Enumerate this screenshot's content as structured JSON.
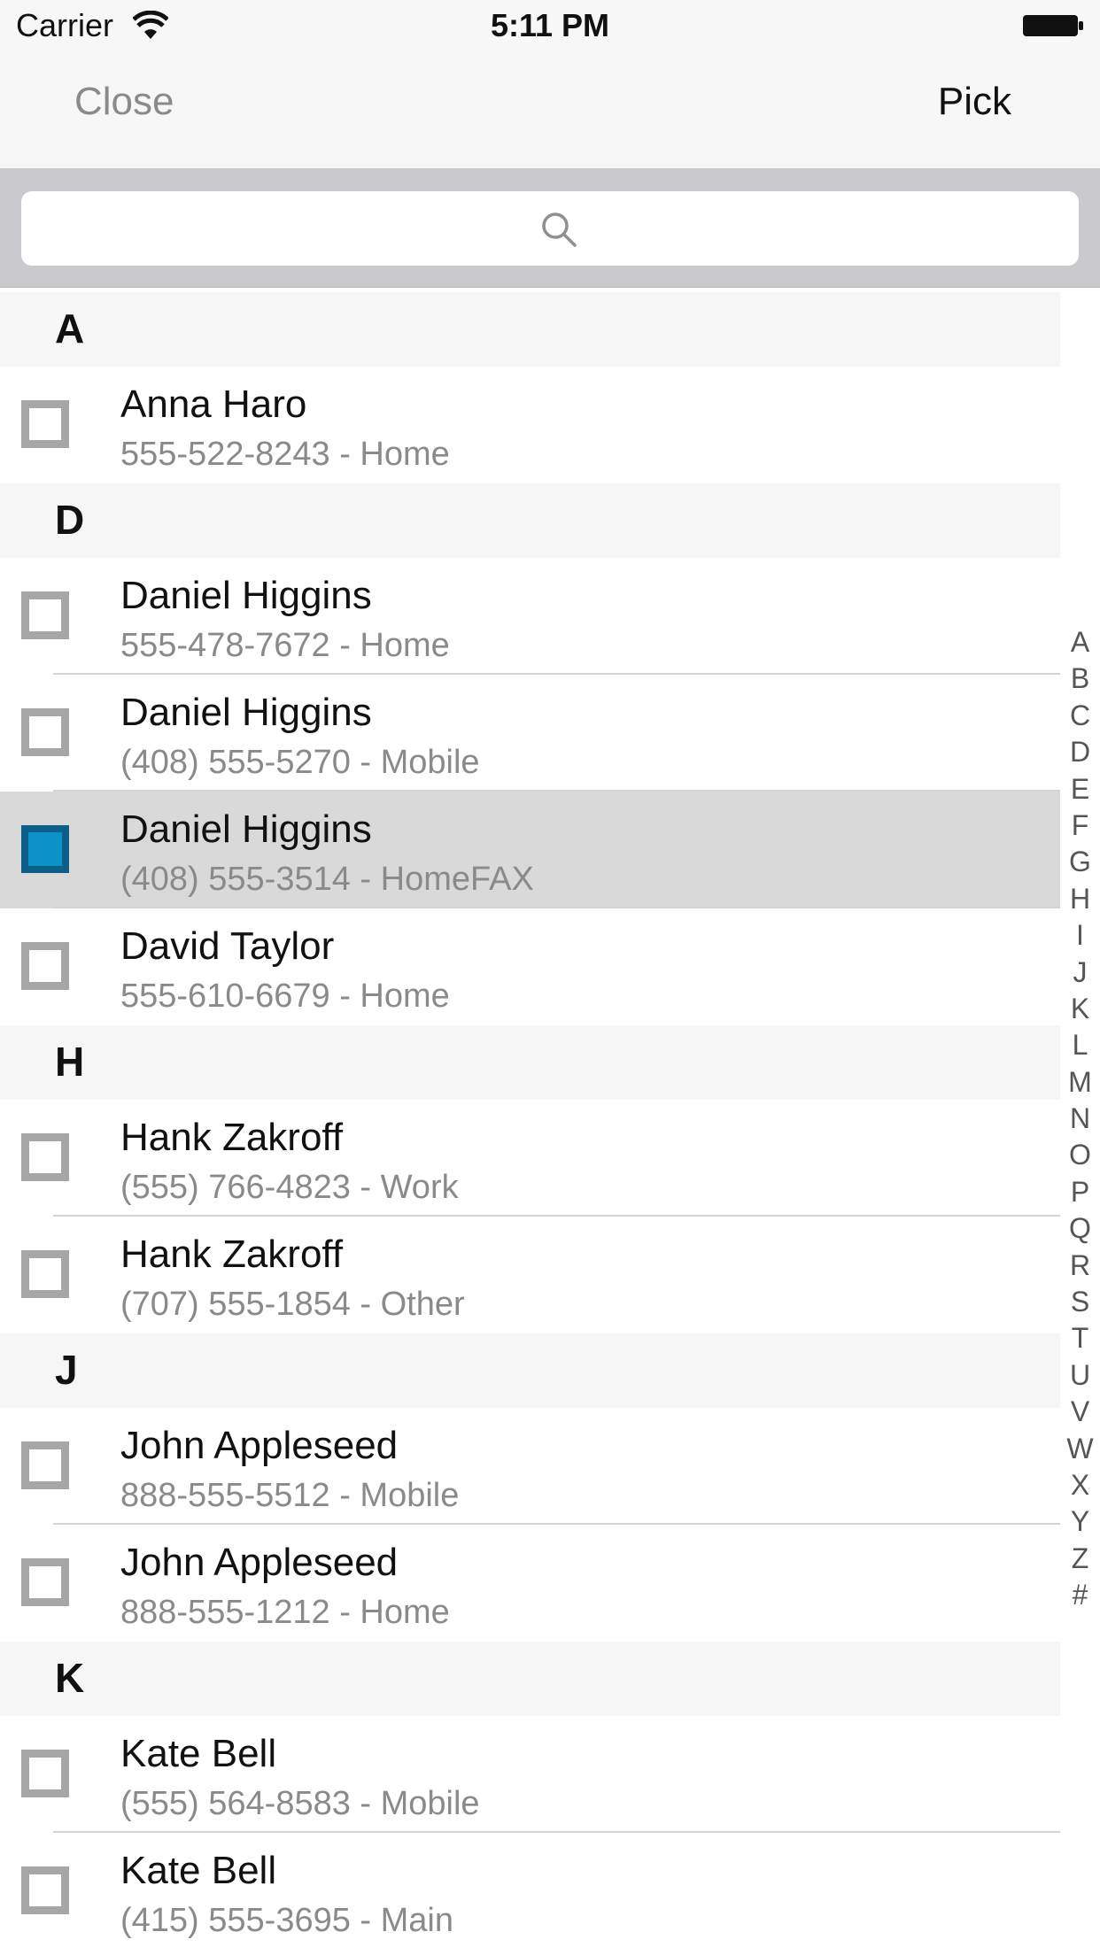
{
  "status_bar": {
    "carrier": "Carrier",
    "time": "5:11 PM"
  },
  "nav": {
    "close_label": "Close",
    "pick_label": "Pick"
  },
  "search": {
    "placeholder": ""
  },
  "sections": [
    {
      "letter": "A",
      "contacts": [
        {
          "name": "Anna Haro",
          "detail": "555-522-8243 - Home",
          "checked": false
        }
      ]
    },
    {
      "letter": "D",
      "contacts": [
        {
          "name": "Daniel Higgins",
          "detail": "555-478-7672 - Home",
          "checked": false
        },
        {
          "name": "Daniel Higgins",
          "detail": "(408) 555-5270 - Mobile",
          "checked": false
        },
        {
          "name": "Daniel Higgins",
          "detail": "(408) 555-3514 - HomeFAX",
          "checked": true
        },
        {
          "name": "David Taylor",
          "detail": "555-610-6679 - Home",
          "checked": false
        }
      ]
    },
    {
      "letter": "H",
      "contacts": [
        {
          "name": "Hank Zakroff",
          "detail": "(555) 766-4823 - Work",
          "checked": false
        },
        {
          "name": "Hank Zakroff",
          "detail": "(707) 555-1854 - Other",
          "checked": false
        }
      ]
    },
    {
      "letter": "J",
      "contacts": [
        {
          "name": "John Appleseed",
          "detail": "888-555-5512 - Mobile",
          "checked": false
        },
        {
          "name": "John Appleseed",
          "detail": "888-555-1212 - Home",
          "checked": false
        }
      ]
    },
    {
      "letter": "K",
      "contacts": [
        {
          "name": "Kate Bell",
          "detail": "(555) 564-8583 - Mobile",
          "checked": false
        },
        {
          "name": "Kate Bell",
          "detail": "(415) 555-3695 - Main",
          "checked": false
        }
      ]
    }
  ],
  "index_letters": [
    "A",
    "B",
    "C",
    "D",
    "E",
    "F",
    "G",
    "H",
    "I",
    "J",
    "K",
    "L",
    "M",
    "N",
    "O",
    "P",
    "Q",
    "R",
    "S",
    "T",
    "U",
    "V",
    "W",
    "X",
    "Y",
    "Z",
    "#"
  ],
  "colors": {
    "checked_fill": "#0b93c9",
    "selected_row": "#d9d9d9",
    "checkbox_border": "#a6a6a6"
  }
}
